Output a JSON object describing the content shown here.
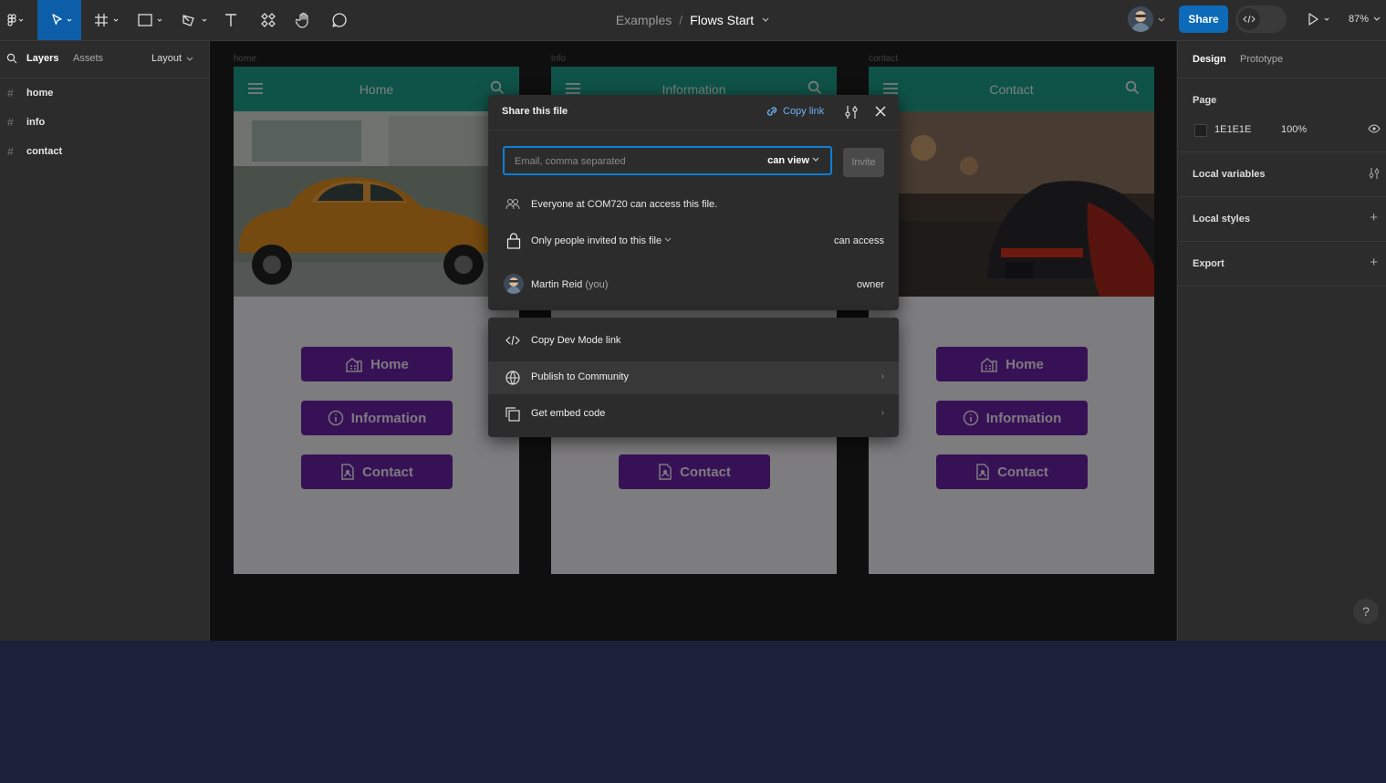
{
  "toolbar": {
    "breadcrumb_project": "Examples",
    "breadcrumb_sep": "/",
    "file_name": "Flows Start",
    "share_label": "Share",
    "zoom_label": "87%"
  },
  "left_panel": {
    "tabs": [
      "Layers",
      "Assets",
      "Layout"
    ],
    "layers": [
      "home",
      "info",
      "contact"
    ]
  },
  "right_panel": {
    "tabs": [
      "Design",
      "Prototype"
    ],
    "page_heading": "Page",
    "page_color": "1E1E1E",
    "page_opacity": "100%",
    "local_variables": "Local variables",
    "local_styles": "Local styles",
    "export": "Export",
    "help": "?"
  },
  "canvas": {
    "frames": [
      {
        "label": "home",
        "title": "Home"
      },
      {
        "label": "info",
        "title": "Information"
      },
      {
        "label": "contact",
        "title": "Contact"
      }
    ],
    "buttons": [
      "Home",
      "Information",
      "Contact"
    ]
  },
  "share_dialog": {
    "title": "Share this file",
    "copy_link": "Copy link",
    "email_placeholder": "Email, comma separated",
    "permission": "can view",
    "invite": "Invite",
    "org_access": "Everyone at COM720 can access this file.",
    "restriction": "Only people invited to this file",
    "restriction_perm": "can access",
    "user_name": "Martin Reid",
    "user_you": "(you)",
    "user_role": "owner"
  },
  "share_menu": {
    "items": [
      "Copy Dev Mode link",
      "Publish to Community",
      "Get embed code"
    ]
  },
  "colors": {
    "accent": "#0d6ab8",
    "header_teal": "#1da08a",
    "button_purple": "#6a21a3"
  }
}
